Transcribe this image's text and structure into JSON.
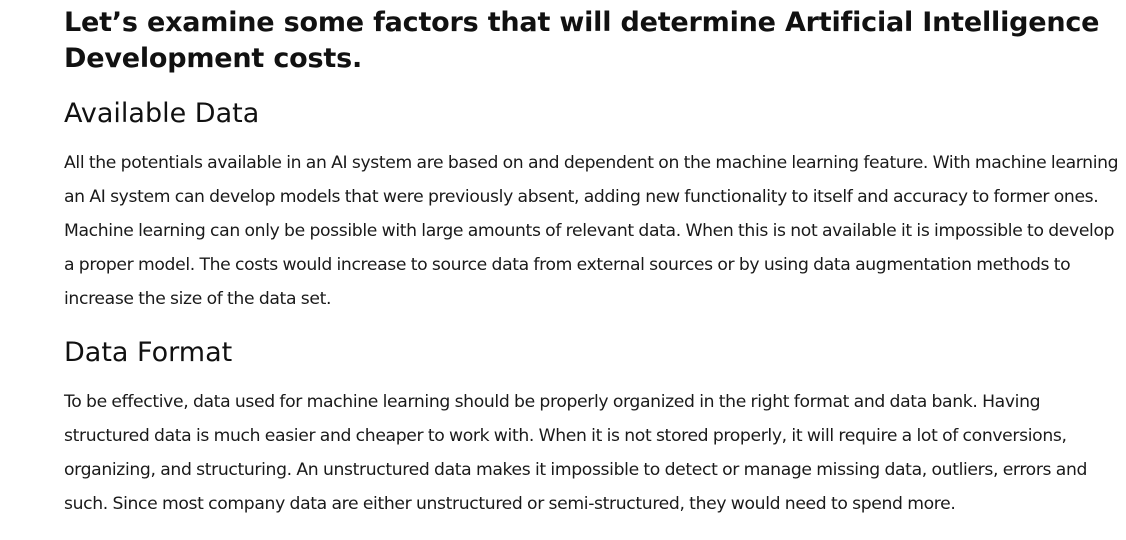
{
  "article": {
    "title": "Let’s examine some factors that will determine Artificial Intelligence Development costs.",
    "sections": [
      {
        "heading": "Available Data",
        "body": "All the potentials available in an AI system are based on and dependent on the machine learning feature. With machine learning an AI system can develop models that were previously absent, adding new functionality to itself and accuracy to former ones. Machine learning can only be possible with large amounts of relevant data. When this is not available it is impossible to develop a proper model. The costs would increase to source data from external sources or by using data augmentation methods to increase the size of the data set."
      },
      {
        "heading": "Data Format",
        "body": "To be effective, data used for machine learning should be properly organized in the right format and data bank. Having structured data is much easier and cheaper to work with. When it is not stored properly, it will require a lot of conversions, organizing, and structuring. An unstructured data makes it impossible to detect or manage missing data, outliers, errors and such. Since most company data are either unstructured or semi-structured, they would need to spend more."
      }
    ]
  }
}
